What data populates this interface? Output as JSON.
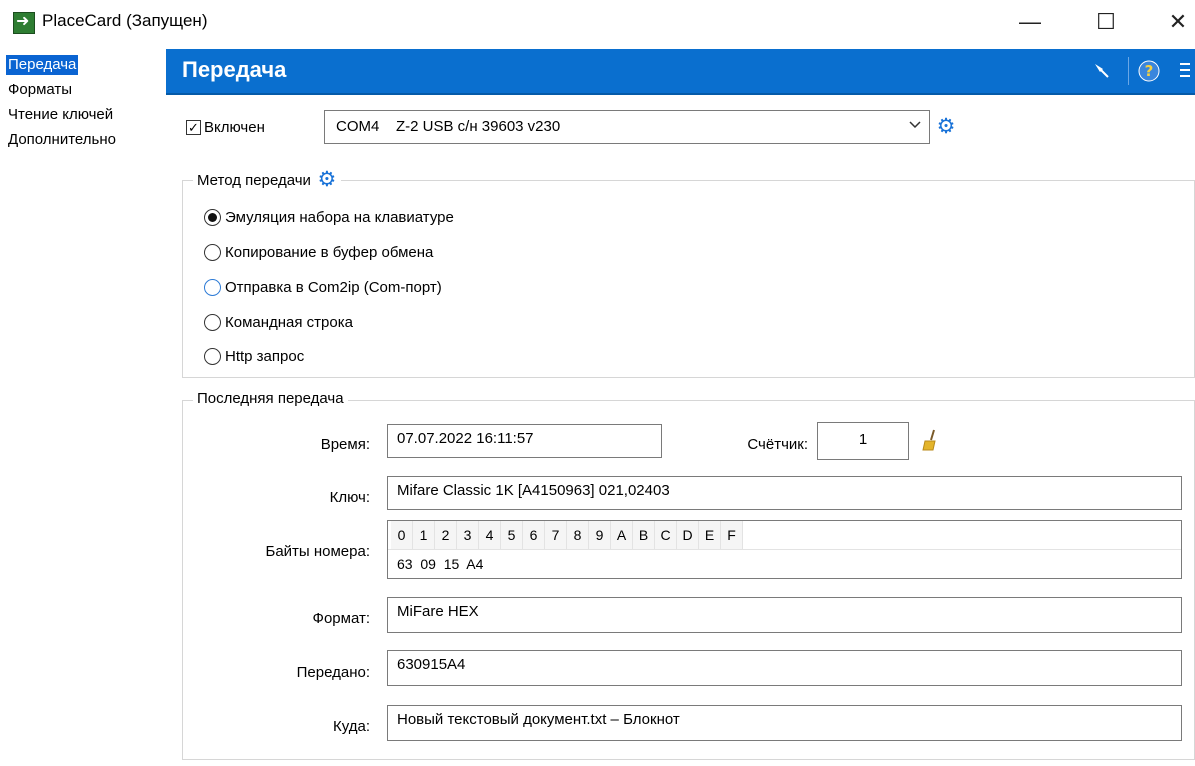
{
  "window": {
    "title": "PlaceCard (Запущен)",
    "controls": {
      "minimize": "—",
      "maximize": "☐",
      "close": "✕"
    }
  },
  "nav": {
    "items": [
      {
        "label": "Передача",
        "active": true
      },
      {
        "label": "Форматы",
        "active": false
      },
      {
        "label": "Чтение ключей",
        "active": false
      },
      {
        "label": "Дополнительно",
        "active": false
      }
    ]
  },
  "header": {
    "title": "Передача",
    "accent_color": "#0a6fcf",
    "icons": [
      "pin-icon",
      "help-icon",
      "menu-icon"
    ]
  },
  "device": {
    "enabled_label": "Включен",
    "enabled_checked": true,
    "port_value": "COM4    Z-2 USB с/н 39603 v230"
  },
  "method": {
    "caption": "Метод передачи",
    "options": [
      {
        "label": "Эмуляция набора на клавиатуре",
        "selected": true
      },
      {
        "label": "Копирование в буфер обмена",
        "selected": false
      },
      {
        "label": "Отправка в Com2ip (Com-порт)",
        "selected": false,
        "focused": true
      },
      {
        "label": "Командная строка",
        "selected": false
      },
      {
        "label": "Http запрос",
        "selected": false
      }
    ]
  },
  "last": {
    "caption": "Последняя передача",
    "time_label": "Время:",
    "time_value": "07.07.2022 16:11:57",
    "counter_label": "Счётчик:",
    "counter_value": "1",
    "key_label": "Ключ:",
    "key_value": "Mifare Classic 1K [A4150963] 021,02403",
    "bytes_label": "Байты номера:",
    "bytes_header": [
      "0",
      "1",
      "2",
      "3",
      "4",
      "5",
      "6",
      "7",
      "8",
      "9",
      "A",
      "B",
      "C",
      "D",
      "E",
      "F"
    ],
    "bytes_value": "63  09  15  A4",
    "format_label": "Формат:",
    "format_value": "MiFare HEX",
    "sent_label": "Передано:",
    "sent_value": "630915A4",
    "target_label": "Куда:",
    "target_value": "Новый текстовый документ.txt – Блокнот"
  }
}
